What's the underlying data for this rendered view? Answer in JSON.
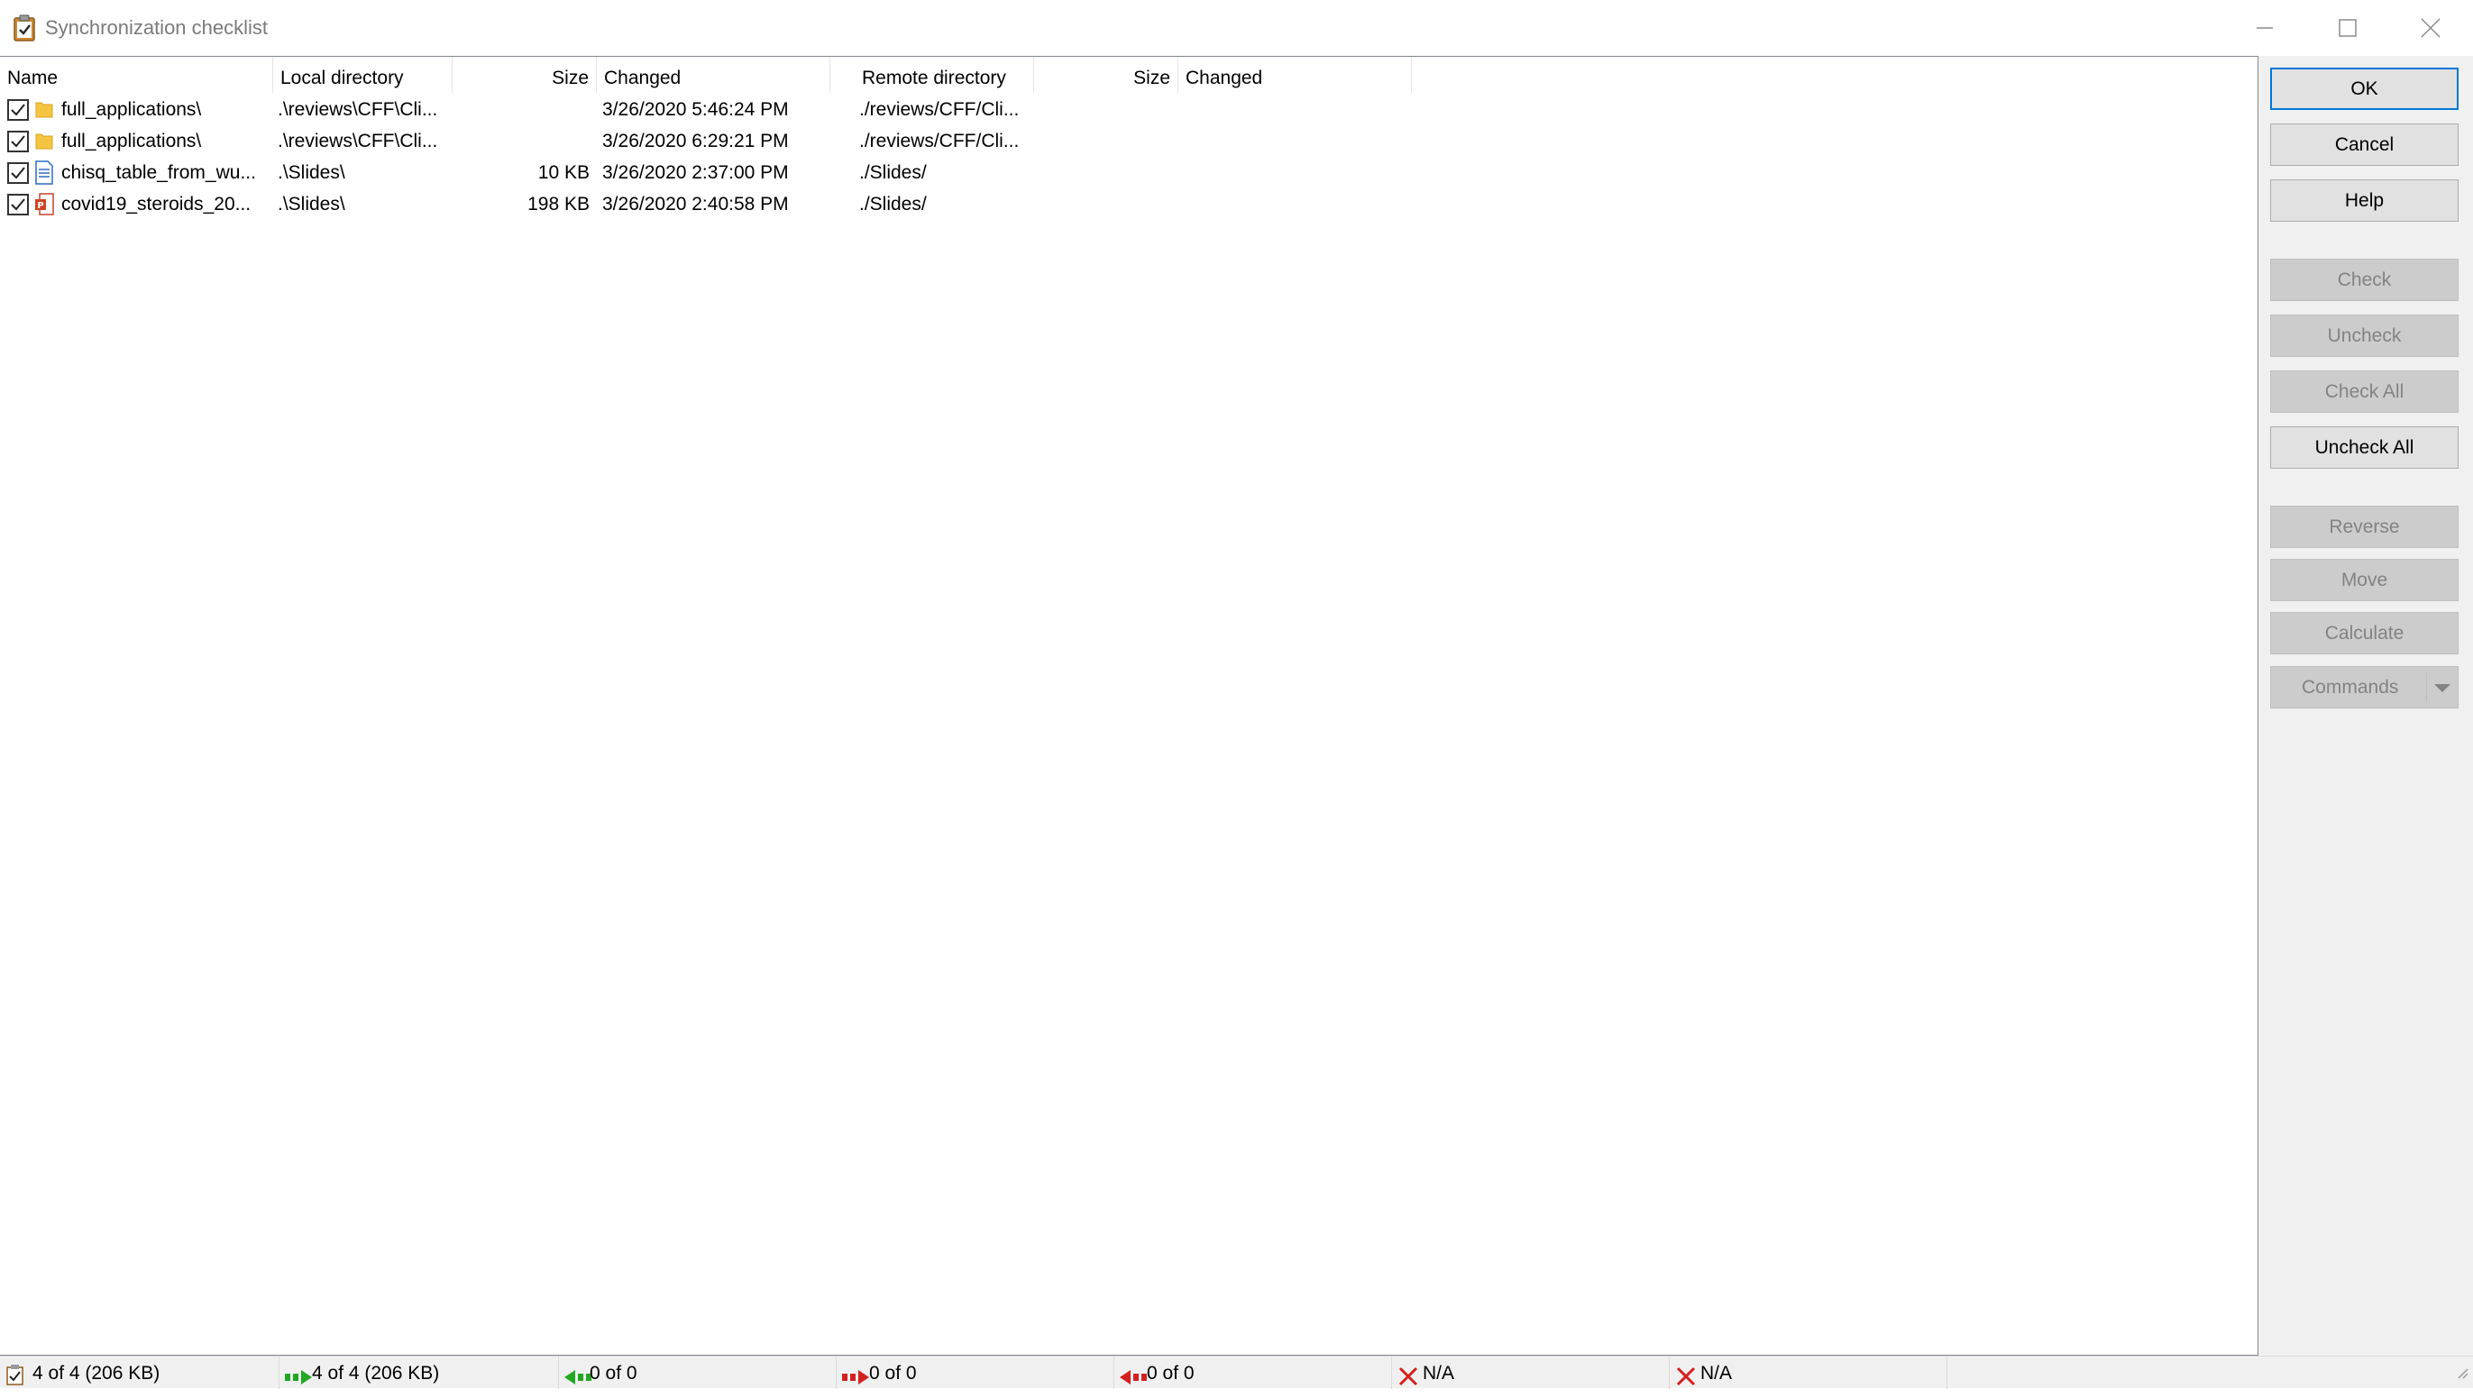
{
  "window": {
    "title": "Synchronization checklist",
    "icon": "clipboard-check-icon"
  },
  "columns": [
    {
      "label": "Name"
    },
    {
      "label": "Local directory"
    },
    {
      "label": "Size"
    },
    {
      "label": "Changed"
    },
    {
      "label": "Remote directory"
    },
    {
      "label": "Size"
    },
    {
      "label": "Changed"
    }
  ],
  "rows": [
    {
      "checked": true,
      "icon": "folder-icon",
      "name": "full_applications\\",
      "local_dir": ".\\reviews\\CFF\\Cli...",
      "local_size": "",
      "local_changed": "3/26/2020 5:46:24 PM",
      "remote_dir": "./reviews/CFF/Cli...",
      "remote_size": "",
      "remote_changed": ""
    },
    {
      "checked": true,
      "icon": "folder-icon",
      "name": "full_applications\\",
      "local_dir": ".\\reviews\\CFF\\Cli...",
      "local_size": "",
      "local_changed": "3/26/2020 6:29:21 PM",
      "remote_dir": "./reviews/CFF/Cli...",
      "remote_size": "",
      "remote_changed": ""
    },
    {
      "checked": true,
      "icon": "document-icon",
      "name": "chisq_table_from_wu...",
      "local_dir": ".\\Slides\\",
      "local_size": "10 KB",
      "local_changed": "3/26/2020 2:37:00 PM",
      "remote_dir": "./Slides/",
      "remote_size": "",
      "remote_changed": ""
    },
    {
      "checked": true,
      "icon": "powerpoint-file-icon",
      "name": "covid19_steroids_20...",
      "local_dir": ".\\Slides\\",
      "local_size": "198 KB",
      "local_changed": "3/26/2020 2:40:58 PM",
      "remote_dir": "./Slides/",
      "remote_size": "",
      "remote_changed": ""
    }
  ],
  "buttons": {
    "ok": "OK",
    "cancel": "Cancel",
    "help": "Help",
    "check": "Check",
    "uncheck": "Uncheck",
    "check_all": "Check All",
    "uncheck_all": "Uncheck All",
    "reverse": "Reverse",
    "move": "Move",
    "calculate": "Calculate",
    "commands": "Commands"
  },
  "status": [
    {
      "icon": "checklist-icon",
      "text": "4 of 4 (206 KB)"
    },
    {
      "icon": "upload-arrow-green-icon",
      "text": "4 of 4 (206 KB)"
    },
    {
      "icon": "download-arrow-green-icon",
      "text": "0 of 0"
    },
    {
      "icon": "delete-remote-red-icon",
      "text": "0 of 0"
    },
    {
      "icon": "delete-local-red-icon",
      "text": "0 of 0"
    },
    {
      "icon": "red-x-icon",
      "text": "N/A"
    },
    {
      "icon": "red-x-icon",
      "text": "N/A"
    }
  ],
  "colors": {
    "accent": "#0078d7",
    "status_green": "#22a822",
    "status_red": "#d42020"
  }
}
